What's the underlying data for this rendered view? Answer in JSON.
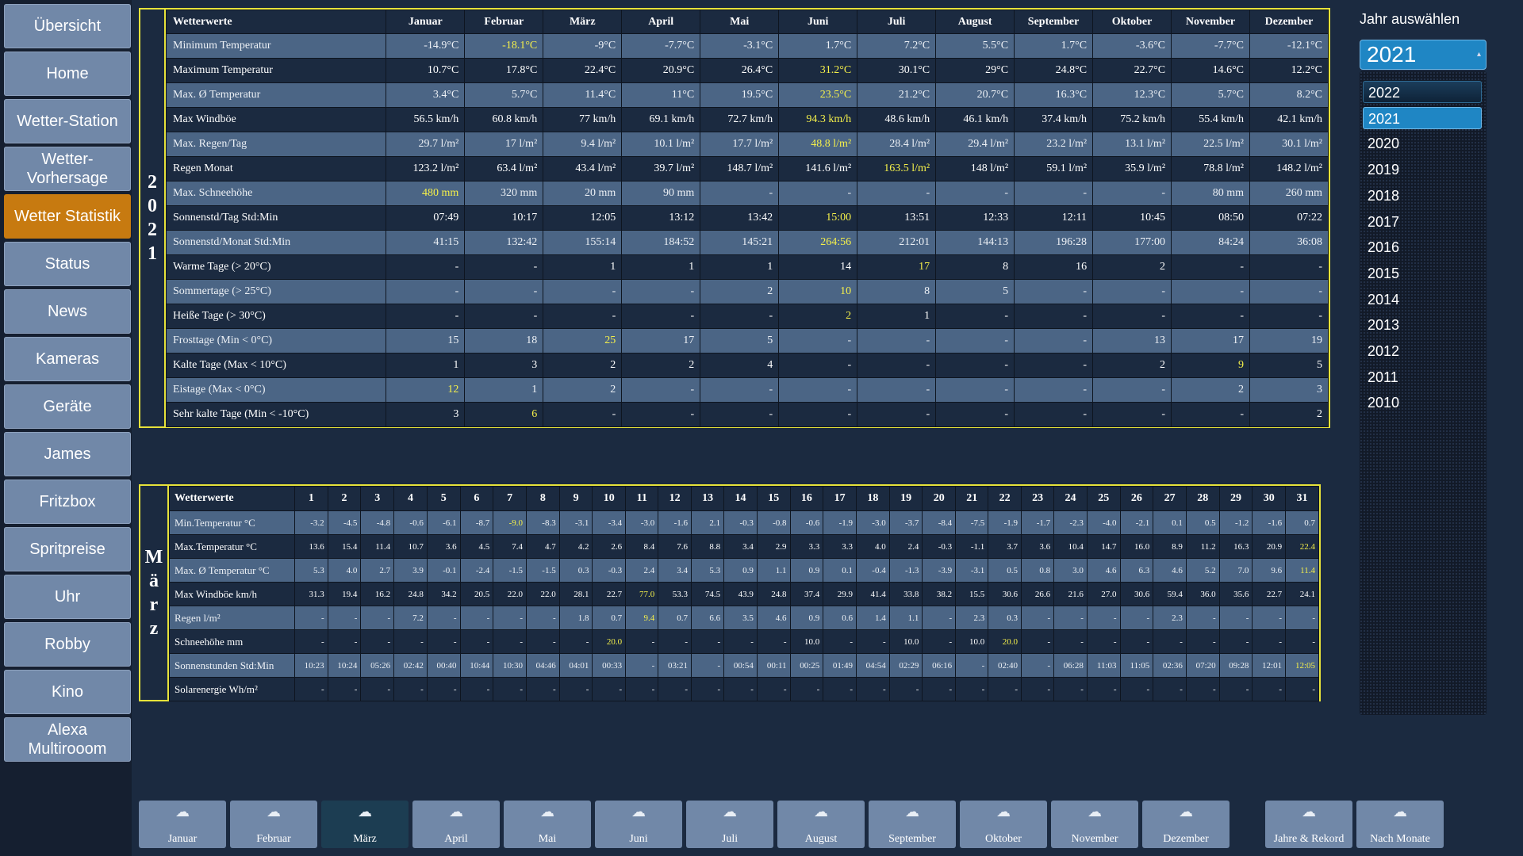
{
  "sidebar": {
    "items": [
      {
        "label": "Übersicht"
      },
      {
        "label": "Home"
      },
      {
        "label": "Wetter-Station"
      },
      {
        "label": "Wetter-\nVorhersage"
      },
      {
        "label": "Wetter Statistik",
        "active": true
      },
      {
        "label": "Status"
      },
      {
        "label": "News"
      },
      {
        "label": "Kameras"
      },
      {
        "label": "Geräte"
      },
      {
        "label": "James"
      },
      {
        "label": "Fritzbox"
      },
      {
        "label": "Spritpreise"
      },
      {
        "label": "Uhr"
      },
      {
        "label": "Robby"
      },
      {
        "label": "Kino"
      },
      {
        "label": "Alexa\nMultirooom"
      }
    ]
  },
  "year_table": {
    "year_label": "2021",
    "header": [
      "Wetterwerte",
      "Januar",
      "Februar",
      "März",
      "April",
      "Mai",
      "Juni",
      "Juli",
      "August",
      "September",
      "Oktober",
      "November",
      "Dezember"
    ],
    "rows": [
      {
        "label": "Minimum Temperatur",
        "values": [
          "-14.9°C",
          "-18.1°C",
          "-9°C",
          "-7.7°C",
          "-3.1°C",
          "1.7°C",
          "7.2°C",
          "5.5°C",
          "1.7°C",
          "-3.6°C",
          "-7.7°C",
          "-12.1°C"
        ],
        "hl": [
          1
        ]
      },
      {
        "label": "Maximum Temperatur",
        "values": [
          "10.7°C",
          "17.8°C",
          "22.4°C",
          "20.9°C",
          "26.4°C",
          "31.2°C",
          "30.1°C",
          "29°C",
          "24.8°C",
          "22.7°C",
          "14.6°C",
          "12.2°C"
        ],
        "hl": [
          5
        ]
      },
      {
        "label": "Max. Ø Temperatur",
        "values": [
          "3.4°C",
          "5.7°C",
          "11.4°C",
          "11°C",
          "19.5°C",
          "23.5°C",
          "21.2°C",
          "20.7°C",
          "16.3°C",
          "12.3°C",
          "5.7°C",
          "8.2°C"
        ],
        "hl": [
          5
        ]
      },
      {
        "label": "Max Windböe",
        "values": [
          "56.5 km/h",
          "60.8 km/h",
          "77 km/h",
          "69.1 km/h",
          "72.7 km/h",
          "94.3 km/h",
          "48.6 km/h",
          "46.1 km/h",
          "37.4 km/h",
          "75.2 km/h",
          "55.4 km/h",
          "42.1 km/h"
        ],
        "hl": [
          5
        ]
      },
      {
        "label": "Max. Regen/Tag",
        "values": [
          "29.7 l/m²",
          "17 l/m²",
          "9.4 l/m²",
          "10.1 l/m²",
          "17.7 l/m²",
          "48.8 l/m²",
          "28.4 l/m²",
          "29.4 l/m²",
          "23.2 l/m²",
          "13.1 l/m²",
          "22.5 l/m²",
          "30.1 l/m²"
        ],
        "hl": [
          5
        ]
      },
      {
        "label": "Regen Monat",
        "values": [
          "123.2 l/m²",
          "63.4 l/m²",
          "43.4 l/m²",
          "39.7 l/m²",
          "148.7 l/m²",
          "141.6 l/m²",
          "163.5 l/m²",
          "148 l/m²",
          "59.1 l/m²",
          "35.9 l/m²",
          "78.8 l/m²",
          "148.2 l/m²"
        ],
        "hl": [
          6
        ]
      },
      {
        "label": "Max. Schneehöhe",
        "values": [
          "480 mm",
          "320 mm",
          "20 mm",
          "90 mm",
          "-",
          "-",
          "-",
          "-",
          "-",
          "-",
          "80 mm",
          "260 mm"
        ],
        "hl": [
          0
        ]
      },
      {
        "label": "Sonnenstd/Tag Std:Min",
        "values": [
          "07:49",
          "10:17",
          "12:05",
          "13:12",
          "13:42",
          "15:00",
          "13:51",
          "12:33",
          "12:11",
          "10:45",
          "08:50",
          "07:22"
        ],
        "hl": [
          5
        ]
      },
      {
        "label": "Sonnenstd/Monat Std:Min",
        "values": [
          "41:15",
          "132:42",
          "155:14",
          "184:52",
          "145:21",
          "264:56",
          "212:01",
          "144:13",
          "196:28",
          "177:00",
          "84:24",
          "36:08"
        ],
        "hl": [
          5
        ]
      },
      {
        "label": "Warme Tage (> 20°C)",
        "values": [
          "-",
          "-",
          "1",
          "1",
          "1",
          "14",
          "17",
          "8",
          "16",
          "2",
          "-",
          "-"
        ],
        "hl": [
          6
        ]
      },
      {
        "label": "Sommertage (> 25°C)",
        "values": [
          "-",
          "-",
          "-",
          "-",
          "2",
          "10",
          "8",
          "5",
          "-",
          "-",
          "-",
          "-"
        ],
        "hl": [
          5
        ]
      },
      {
        "label": "Heiße Tage (> 30°C)",
        "values": [
          "-",
          "-",
          "-",
          "-",
          "-",
          "2",
          "1",
          "-",
          "-",
          "-",
          "-",
          "-"
        ],
        "hl": [
          5
        ]
      },
      {
        "label": "Frosttage (Min < 0°C)",
        "values": [
          "15",
          "18",
          "25",
          "17",
          "5",
          "-",
          "-",
          "-",
          "-",
          "13",
          "17",
          "19"
        ],
        "hl": [
          2
        ]
      },
      {
        "label": "Kalte Tage (Max < 10°C)",
        "values": [
          "1",
          "3",
          "2",
          "2",
          "4",
          "-",
          "-",
          "-",
          "-",
          "2",
          "9",
          "5"
        ],
        "hl": [
          10
        ]
      },
      {
        "label": "Eistage (Max < 0°C)",
        "values": [
          "12",
          "1",
          "2",
          "-",
          "-",
          "-",
          "-",
          "-",
          "-",
          "-",
          "2",
          "3"
        ],
        "hl": [
          0
        ]
      },
      {
        "label": "Sehr kalte Tage (Min < -10°C)",
        "values": [
          "3",
          "6",
          "-",
          "-",
          "-",
          "-",
          "-",
          "-",
          "-",
          "-",
          "-",
          "2"
        ],
        "hl": [
          1
        ]
      }
    ]
  },
  "month_table": {
    "month_label": "März",
    "header": [
      "Wetterwerte",
      "1",
      "2",
      "3",
      "4",
      "5",
      "6",
      "7",
      "8",
      "9",
      "10",
      "11",
      "12",
      "13",
      "14",
      "15",
      "16",
      "17",
      "18",
      "19",
      "20",
      "21",
      "22",
      "23",
      "24",
      "25",
      "26",
      "27",
      "28",
      "29",
      "30",
      "31"
    ],
    "rows": [
      {
        "label": "Min.Temperatur °C",
        "values": [
          "-3.2",
          "-4.5",
          "-4.8",
          "-0.6",
          "-6.1",
          "-8.7",
          "-9.0",
          "-8.3",
          "-3.1",
          "-3.4",
          "-3.0",
          "-1.6",
          "2.1",
          "-0.3",
          "-0.8",
          "-0.6",
          "-1.9",
          "-3.0",
          "-3.7",
          "-8.4",
          "-7.5",
          "-1.9",
          "-1.7",
          "-2.3",
          "-4.0",
          "-2.1",
          "0.1",
          "0.5",
          "-1.2",
          "-1.6",
          "0.7"
        ],
        "hl": [
          6
        ]
      },
      {
        "label": "Max.Temperatur °C",
        "values": [
          "13.6",
          "15.4",
          "11.4",
          "10.7",
          "3.6",
          "4.5",
          "7.4",
          "4.7",
          "4.2",
          "2.6",
          "8.4",
          "7.6",
          "8.8",
          "3.4",
          "2.9",
          "3.3",
          "3.3",
          "4.0",
          "2.4",
          "-0.3",
          "-1.1",
          "3.7",
          "3.6",
          "10.4",
          "14.7",
          "16.0",
          "8.9",
          "11.2",
          "16.3",
          "20.9",
          "22.4"
        ],
        "hl": [
          30
        ]
      },
      {
        "label": "Max. Ø Temperatur °C",
        "values": [
          "5.3",
          "4.0",
          "2.7",
          "3.9",
          "-0.1",
          "-2.4",
          "-1.5",
          "-1.5",
          "0.3",
          "-0.3",
          "2.4",
          "3.4",
          "5.3",
          "0.9",
          "1.1",
          "0.9",
          "0.1",
          "-0.4",
          "-1.3",
          "-3.9",
          "-3.1",
          "0.5",
          "0.8",
          "3.0",
          "4.6",
          "6.3",
          "4.6",
          "5.2",
          "7.0",
          "9.6",
          "11.4"
        ],
        "hl": [
          30
        ]
      },
      {
        "label": "Max Windböe km/h",
        "values": [
          "31.3",
          "19.4",
          "16.2",
          "24.8",
          "34.2",
          "20.5",
          "22.0",
          "22.0",
          "28.1",
          "22.7",
          "77.0",
          "53.3",
          "74.5",
          "43.9",
          "24.8",
          "37.4",
          "29.9",
          "41.4",
          "33.8",
          "38.2",
          "15.5",
          "30.6",
          "26.6",
          "21.6",
          "27.0",
          "30.6",
          "59.4",
          "36.0",
          "35.6",
          "22.7",
          "24.1"
        ],
        "hl": [
          10
        ]
      },
      {
        "label": "Regen l/m²",
        "values": [
          "-",
          "-",
          "-",
          "7.2",
          "-",
          "-",
          "-",
          "-",
          "1.8",
          "0.7",
          "9.4",
          "0.7",
          "6.6",
          "3.5",
          "4.6",
          "0.9",
          "0.6",
          "1.4",
          "1.1",
          "-",
          "2.3",
          "0.3",
          "-",
          "-",
          "-",
          "-",
          "2.3",
          "-",
          "-",
          "-",
          "-"
        ],
        "hl": [
          10
        ]
      },
      {
        "label": "Schneehöhe mm",
        "values": [
          "-",
          "-",
          "-",
          "-",
          "-",
          "-",
          "-",
          "-",
          "-",
          "20.0",
          "-",
          "-",
          "-",
          "-",
          "-",
          "10.0",
          "-",
          "-",
          "10.0",
          "-",
          "10.0",
          "20.0",
          "-",
          "-",
          "-",
          "-",
          "-",
          "-",
          "-",
          "-",
          "-"
        ],
        "hl": [
          9,
          21
        ]
      },
      {
        "label": "Sonnenstunden Std:Min",
        "values": [
          "10:23",
          "10:24",
          "05:26",
          "02:42",
          "00:40",
          "10:44",
          "10:30",
          "04:46",
          "04:01",
          "00:33",
          "-",
          "03:21",
          "-",
          "00:54",
          "00:11",
          "00:25",
          "01:49",
          "04:54",
          "02:29",
          "06:16",
          "-",
          "02:40",
          "-",
          "06:28",
          "11:03",
          "11:05",
          "02:36",
          "07:20",
          "09:28",
          "12:01",
          "12:05"
        ],
        "hl": [
          30
        ]
      },
      {
        "label": "Solarenergie Wh/m²",
        "values": [
          "-",
          "-",
          "-",
          "-",
          "-",
          "-",
          "-",
          "-",
          "-",
          "-",
          "-",
          "-",
          "-",
          "-",
          "-",
          "-",
          "-",
          "-",
          "-",
          "-",
          "-",
          "-",
          "-",
          "-",
          "-",
          "-",
          "-",
          "-",
          "-",
          "-",
          "-"
        ],
        "hl": []
      }
    ]
  },
  "year_selector": {
    "title": "Jahr auswählen",
    "selected": "2021",
    "options": [
      "2022",
      "2021",
      "2020",
      "2019",
      "2018",
      "2017",
      "2016",
      "2015",
      "2014",
      "2013",
      "2012",
      "2011",
      "2010"
    ]
  },
  "bottom_buttons": [
    {
      "label": "Januar"
    },
    {
      "label": "Februar"
    },
    {
      "label": "März",
      "active": true
    },
    {
      "label": "April"
    },
    {
      "label": "Mai"
    },
    {
      "label": "Juni"
    },
    {
      "label": "Juli"
    },
    {
      "label": "August"
    },
    {
      "label": "September"
    },
    {
      "label": "Oktober"
    },
    {
      "label": "November"
    },
    {
      "label": "Dezember"
    },
    {
      "label": "Jahre & Rekord"
    },
    {
      "label": "Nach Monate"
    }
  ],
  "colors": {
    "highlight": "#f5f04a",
    "border": "#e6e23a",
    "active_nav": "#c77a10",
    "button": "#7188a8"
  },
  "icons": {
    "month_button": "weather-cloud-sun-icon"
  }
}
